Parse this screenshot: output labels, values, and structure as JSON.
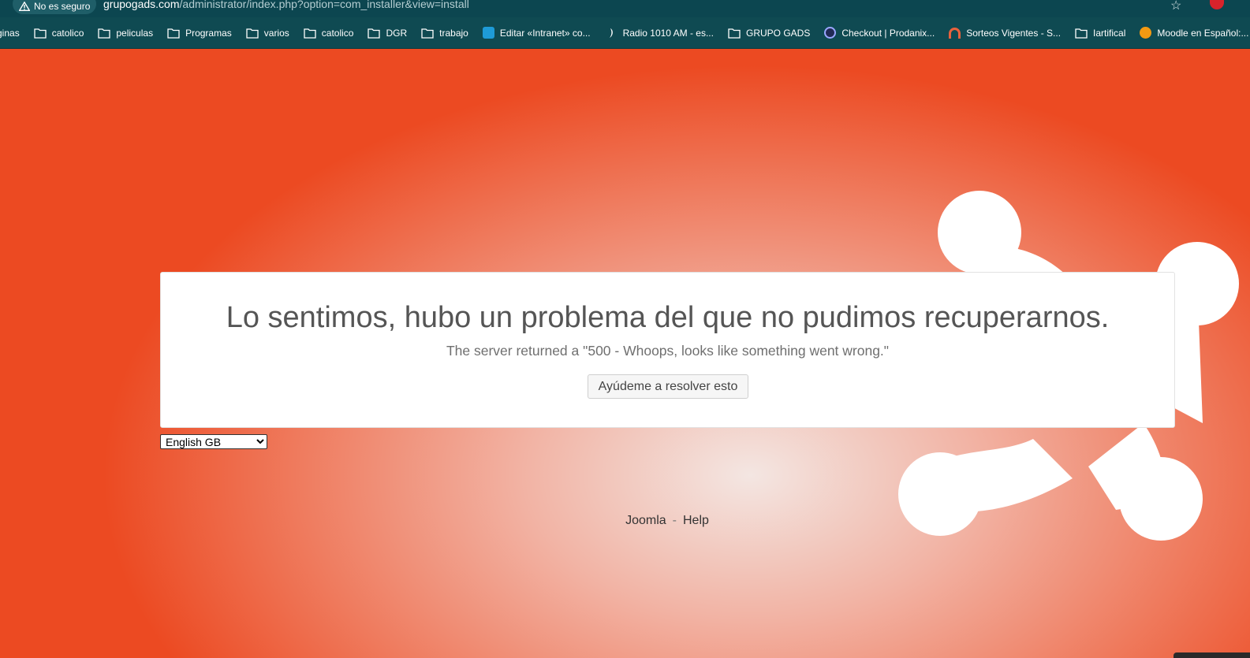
{
  "browser": {
    "security_label": "No es seguro",
    "url_domain": "grupogads.com",
    "url_path": "/administrator/index.php?option=com_installer&view=install",
    "bookmarks": [
      {
        "label": "ginas",
        "icon": "none"
      },
      {
        "label": "catolico",
        "icon": "folder-icon"
      },
      {
        "label": "peliculas",
        "icon": "folder-icon"
      },
      {
        "label": "Programas",
        "icon": "folder-icon"
      },
      {
        "label": "varios",
        "icon": "folder-icon"
      },
      {
        "label": "catolico",
        "icon": "folder-icon"
      },
      {
        "label": "DGR",
        "icon": "folder-icon"
      },
      {
        "label": "trabajo",
        "icon": "folder-icon"
      },
      {
        "label": "Editar «Intranet» co...",
        "icon": "site-favicon"
      },
      {
        "label": "Radio 1010 AM - es...",
        "icon": "site-favicon"
      },
      {
        "label": "GRUPO GADS",
        "icon": "folder-icon"
      },
      {
        "label": "Checkout | Prodanix...",
        "icon": "site-favicon"
      },
      {
        "label": "Sorteos Vigentes - S...",
        "icon": "site-favicon"
      },
      {
        "label": "Iartifical",
        "icon": "folder-icon"
      },
      {
        "label": "Moodle en Español:...",
        "icon": "site-favicon"
      }
    ]
  },
  "error": {
    "title": "Lo sentimos, hubo un problema del que no pudimos recuperarnos.",
    "message": "The server returned a \"500 - Whoops, looks like something went wrong.\"",
    "help_button": "Ayúdeme a resolver esto"
  },
  "language": {
    "selected": "English GB"
  },
  "footer": {
    "link_joomla": "Joomla",
    "separator": "-",
    "link_help": "Help"
  },
  "colors": {
    "browser_bg": "#0f4a52",
    "page_accent": "#ec4a22",
    "card_bg": "#ffffff"
  }
}
